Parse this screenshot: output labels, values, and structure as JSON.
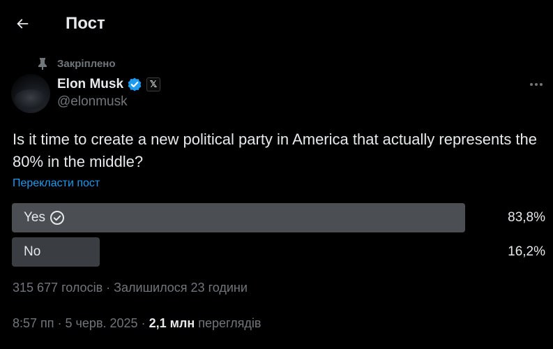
{
  "header": {
    "title": "Пост"
  },
  "pinned": {
    "label": "Закріплено"
  },
  "author": {
    "name": "Elon Musk",
    "handle": "@elonmusk",
    "affiliation_badge": "𝕏"
  },
  "post": {
    "text": "Is it time to create a new political party in America that actually represents the 80% in the middle?",
    "translate_link": "Перекласти пост"
  },
  "poll": {
    "options": [
      {
        "label": "Yes",
        "percent": "83,8%",
        "fraction": 0.838,
        "winner": true
      },
      {
        "label": "No",
        "percent": "16,2%",
        "fraction": 0.162,
        "winner": false
      }
    ],
    "votes": "315 677 голосів",
    "separator": "·",
    "time_left": "Залишилося 23 години"
  },
  "meta": {
    "time": "8:57 пп",
    "date": "5 черв. 2025",
    "separator": "·",
    "views_count": "2,1 млн",
    "views_label": "переглядів"
  },
  "colors": {
    "accent": "#1d9bf0",
    "muted": "#71767b",
    "text": "#e7e9ea",
    "winner_bar": "#4b4f54",
    "loser_bar": "#3a3d41"
  }
}
